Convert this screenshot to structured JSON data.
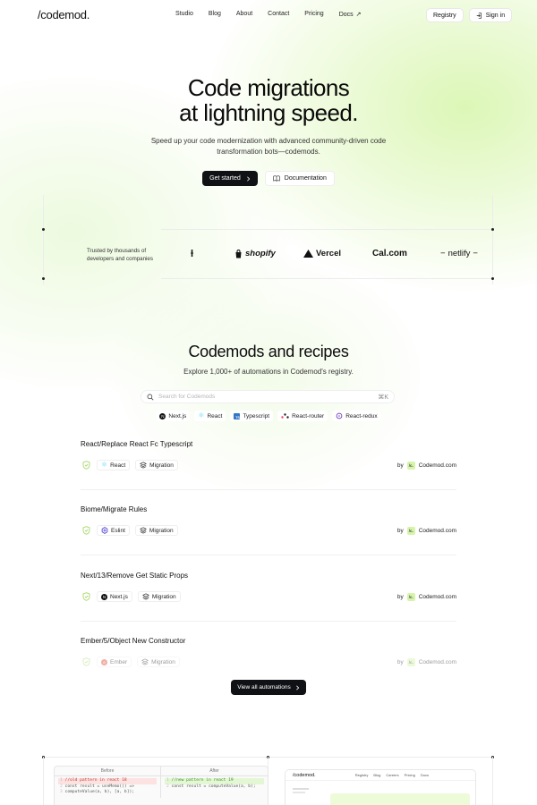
{
  "nav": {
    "logo": "/codemod.",
    "links": [
      "Studio",
      "Blog",
      "About",
      "Contact",
      "Pricing",
      "Docs"
    ],
    "docs_arrow": "↗",
    "registry": "Registry",
    "sign_in": "Sign in"
  },
  "hero": {
    "title_line1": "Code migrations",
    "title_line2": "at lightning speed.",
    "subtitle_line1": "Speed up your code modernization with advanced community-driven code",
    "subtitle_line2": "transformation bots—codemods.",
    "cta_primary": "Get started",
    "cta_secondary": "Documentation"
  },
  "trusted": {
    "line1": "Trusted by thousands of",
    "line2": "developers and companies",
    "brands": [
      "shopify",
      "Vercel",
      "Cal.com",
      "netlify"
    ]
  },
  "registry": {
    "title": "Codemods and recipes",
    "subtitle": "Explore 1,000+ of automations in Codemod's registry.",
    "search_placeholder": "Search for Codemods",
    "search_shortcut": "⌘K",
    "filters": [
      "Next.js",
      "React",
      "Typescript",
      "React-router",
      "React-redux"
    ],
    "cards": [
      {
        "title": "React/Replace React Fc Typescript",
        "framework": "React",
        "kind": "Migration",
        "by": "by",
        "author": "Codemod.com"
      },
      {
        "title": "Biome/Migrate Rules",
        "framework": "Eslint",
        "kind": "Migration",
        "by": "by",
        "author": "Codemod.com"
      },
      {
        "title": "Next/13/Remove Get Static Props",
        "framework": "Next.js",
        "kind": "Migration",
        "by": "by",
        "author": "Codemod.com"
      },
      {
        "title": "Ember/5/Object New Constructor",
        "framework": "Ember",
        "kind": "Migration",
        "by": "by",
        "author": "Codemod.com"
      }
    ],
    "view_all": "View all automations"
  },
  "preview": {
    "before": "Before",
    "after": "After",
    "before_line1": "//old pattern in react 18",
    "before_line2": "const result = useMemo(() =>",
    "before_line3": "computeValue(a, b), [a, b]);",
    "after_line1": "//new pattern in react 19",
    "after_line2": "const result = computeValue(a, b);",
    "app_logo": "/codemod.",
    "app_links": [
      "Registry",
      "Blog",
      "Careers",
      "Pricing",
      "Docs"
    ]
  },
  "colors": {
    "accent_green": "#d6f5a8",
    "dark_button": "#0f1115"
  }
}
